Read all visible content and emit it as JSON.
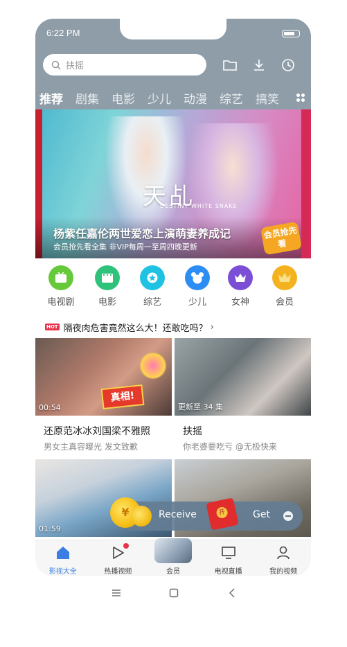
{
  "status": {
    "time": "6:22 PM"
  },
  "search": {
    "placeholder": "扶摇"
  },
  "tabs": [
    "推荐",
    "剧集",
    "电影",
    "少儿",
    "动漫",
    "综艺",
    "搞笑"
  ],
  "banner": {
    "title": "杨紫任嘉伦两世爱恋上演萌妻养成记",
    "subtitle": "会员抢先看全集 非VIP每周一至周四晚更新",
    "logo_cn": "天乩",
    "logo_en": "DESTINY WHITE SNAKE",
    "badge": "会员抢先看"
  },
  "categories": [
    {
      "label": "电视剧",
      "color": "#66c93a",
      "icon": "tv-icon"
    },
    {
      "label": "电影",
      "color": "#2fc27b",
      "icon": "film-icon"
    },
    {
      "label": "综艺",
      "color": "#1fc2e3",
      "icon": "star-icon"
    },
    {
      "label": "少儿",
      "color": "#2c8ef5",
      "icon": "bear-icon"
    },
    {
      "label": "女神",
      "color": "#7a4fd6",
      "icon": "crown-icon"
    },
    {
      "label": "会员",
      "color": "#f5b21f",
      "icon": "vip-crown-icon"
    }
  ],
  "hot": {
    "tag": "HOT",
    "text": "隔夜肉危害竟然这么大！还敢吃吗？"
  },
  "videos": [
    {
      "badge": "00:54",
      "title": "还原范冰冰刘国梁不雅照",
      "subtitle": "男女主真容曝光 发文致歉",
      "stamp": "真相!"
    },
    {
      "badge": "更新至 34 集",
      "title": "扶摇",
      "subtitle": "你老婆要吃亏 @无极快来"
    },
    {
      "badge": "01:59"
    },
    {
      "badge": ""
    }
  ],
  "reward": {
    "receive": "Receive",
    "get": "Get"
  },
  "bottom_nav": [
    {
      "label": "影视大全",
      "icon": "home-icon",
      "active": true
    },
    {
      "label": "热播视频",
      "icon": "play-icon",
      "dot": true
    },
    {
      "label": "会员",
      "icon": "member-avatar"
    },
    {
      "label": "电视直播",
      "icon": "tv-live-icon"
    },
    {
      "label": "我的视频",
      "icon": "profile-icon"
    }
  ]
}
